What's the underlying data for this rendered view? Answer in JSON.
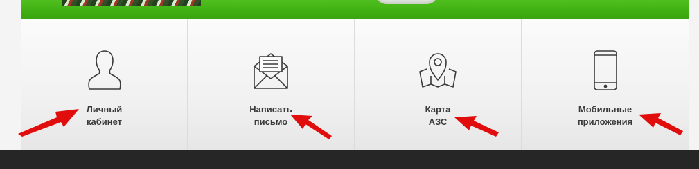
{
  "tiles": [
    {
      "label": "Личный\nкабинет",
      "icon": "user-icon"
    },
    {
      "label": "Написать\nписьмо",
      "icon": "mail-icon"
    },
    {
      "label": "Карта\nАЗС",
      "icon": "map-pin-icon"
    },
    {
      "label": "Мобильные\nприложения",
      "icon": "smartphone-icon"
    }
  ],
  "colors": {
    "banner": "#3fae12",
    "footer": "#262626",
    "annotation_arrow": "#e10c0c",
    "icon_stroke": "#3a3a3a"
  }
}
